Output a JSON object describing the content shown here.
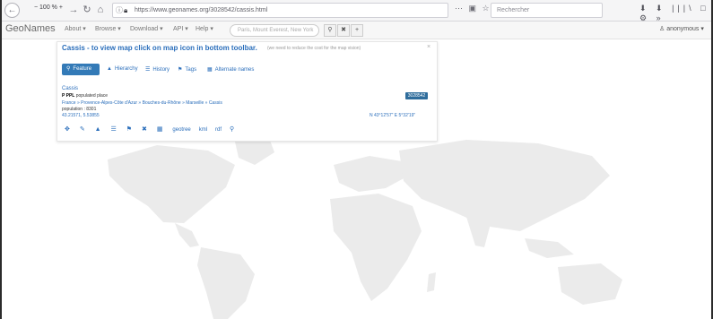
{
  "browser": {
    "back_icon": "←",
    "forward_icon": "→",
    "reload_icon": "↻",
    "home_icon": "⌂",
    "zoom_label": "− 100 % +",
    "url": "https://www.geonames.org/3028542/cassis.html",
    "url_domain": "geonames.org",
    "url_actions": "⋯ ▣ ☆",
    "search_placeholder": "Rechercher",
    "toolbar_icons": "⬇ ⬇ |||\\ □ ⚙ »"
  },
  "navbar": {
    "brand": "GeoNames",
    "links": [
      "About",
      "Browse",
      "Download",
      "API",
      "Help"
    ],
    "search_placeholder": "Paris, Mount Everest, New York",
    "search_icon": "search-icon",
    "clear_icon": "close-icon",
    "add_icon": "plus-icon",
    "user": "anonymous"
  },
  "panel": {
    "title": "Cassis - to view map click on map icon in bottom toolbar.",
    "note": "(we need to reduce the cost for the map vision)",
    "close": "×",
    "tabs": [
      {
        "label": "Feature",
        "icon": "marker-icon"
      },
      {
        "label": "Hierarchy",
        "icon": "hierarchy-icon"
      },
      {
        "label": "History",
        "icon": "list-icon"
      },
      {
        "label": "Tags",
        "icon": "tag-icon"
      },
      {
        "label": "Alternate names",
        "icon": "table-icon"
      }
    ],
    "place_name": "Cassis",
    "feature_code": "P PPL",
    "feature_desc": "populated place",
    "geonameid": "3028542",
    "hierarchy": "France » Provence-Alpes-Côte d'Azur » Bouches-du-Rhône » Marseille » Cassis",
    "population": "population : 8301",
    "coords_left": "43.21571, 5.53855",
    "coords_right": "N 43°12'57\" E 5°32'19\"",
    "tool_labels": [
      "geotree",
      "kml",
      "rdf"
    ]
  },
  "colors": {
    "link": "#2a6ebb",
    "tab_active": "#337ab7",
    "badge": "#2f6d9c",
    "land": "#ebebeb"
  }
}
